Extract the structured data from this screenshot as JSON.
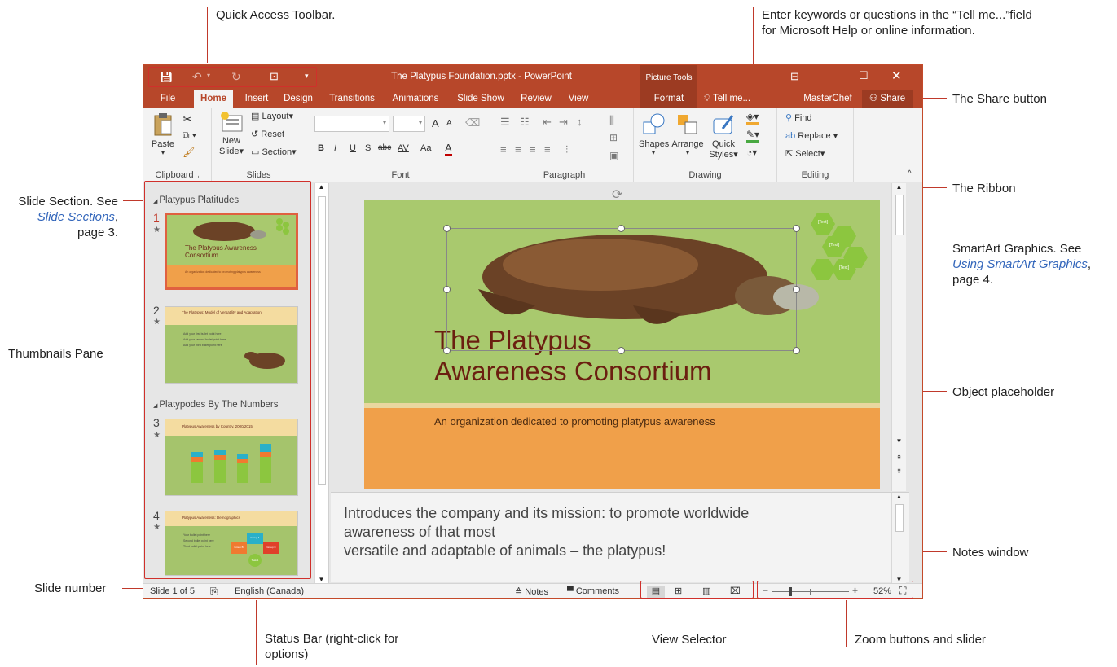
{
  "callouts": {
    "qat": "Quick Access Toolbar.",
    "tell_me_1": "Enter keywords or questions in the “Tell me...”field",
    "tell_me_2": "for Microsoft Help or online information.",
    "share": "The Share button",
    "ribbon": "The Ribbon",
    "slide_section_1": "Slide Section. See",
    "slide_section_link": "Slide Sections",
    "slide_section_2": "page 3.",
    "smartart_1": "SmartArt Graphics. See",
    "smartart_link": "Using SmartArt Graphics",
    "smartart_2": "page 4.",
    "thumbnails": "Thumbnails Pane",
    "object_ph": "Object placeholder",
    "notes_win": "Notes window",
    "slide_number": "Slide number",
    "status_bar_1": "Status Bar (right-click for",
    "status_bar_2": "options)",
    "view_selector": "View Selector",
    "zoom": "Zoom buttons and slider"
  },
  "window": {
    "title": "The Platypus Foundation.pptx - PowerPoint",
    "context_group": "Picture Tools",
    "tabs": [
      "File",
      "Home",
      "Insert",
      "Design",
      "Transitions",
      "Animations",
      "Slide Show",
      "Review",
      "View",
      "Format"
    ],
    "active_tab": "Home",
    "tell_me": "Tell me...",
    "user": "MasterChef",
    "share": "Share",
    "accent": "#b7472a"
  },
  "ribbon": {
    "clipboard": {
      "label": "Clipboard",
      "paste": "Paste"
    },
    "slides": {
      "label": "Slides",
      "new_slide_1": "New",
      "new_slide_2": "Slide",
      "layout": "Layout",
      "reset": "Reset",
      "section": "Section"
    },
    "font": {
      "label": "Font",
      "grow": "A",
      "shrink": "A",
      "bold": "B",
      "italic": "I",
      "underline": "U",
      "shadow": "S",
      "strike": "abc",
      "spacing": "AV",
      "case": "Aa",
      "color": "A"
    },
    "paragraph": {
      "label": "Paragraph"
    },
    "drawing": {
      "label": "Drawing",
      "shapes": "Shapes",
      "arrange": "Arrange",
      "quick_1": "Quick",
      "quick_2": "Styles"
    },
    "editing": {
      "label": "Editing",
      "find": "Find",
      "replace": "Replace",
      "select": "Select"
    }
  },
  "thumbnails": {
    "section1": "Platypus Platitudes",
    "section2": "Platypodes By The Numbers",
    "slides": [
      {
        "num": "1",
        "title": "The Platypus Awareness Consortium",
        "sub": "An organization dedicated to promoting platypus awareness"
      },
      {
        "num": "2",
        "title": "The Platypus: Model of Versatility and Adaptation",
        "bullets": [
          "Add your first bullet point here",
          "Add your second bullet point here",
          "Add your third bullet point here"
        ]
      },
      {
        "num": "3",
        "title": "Platypus Awareness by Country, 2000/2015"
      },
      {
        "num": "4",
        "title": "Platypus Awareness: Demographics",
        "bullets": [
          "Your bullet point here",
          "Second bullet point here",
          "Third bullet point here"
        ],
        "group_a": "Group A",
        "group_b": "Group B",
        "group_c": "Group C",
        "task": "Task 1"
      }
    ],
    "star": "★"
  },
  "slide": {
    "title_line1": "The Platypus",
    "title_line2": "Awareness Consortium",
    "subtitle": "An organization dedicated to promoting platypus awareness",
    "smartart_text": "[Text]"
  },
  "notes": {
    "line1": "Introduces the company and its mission: to promote worldwide",
    "line2": "awareness of that most",
    "line3": "versatile and adaptable of animals – the platypus!"
  },
  "status": {
    "slide_of": "Slide 1 of 5",
    "language": "English (Canada)",
    "notes": "Notes",
    "comments": "Comments",
    "zoom_pct": "52%",
    "minus": "−",
    "plus": "+",
    "zoom_level": 0.52
  }
}
